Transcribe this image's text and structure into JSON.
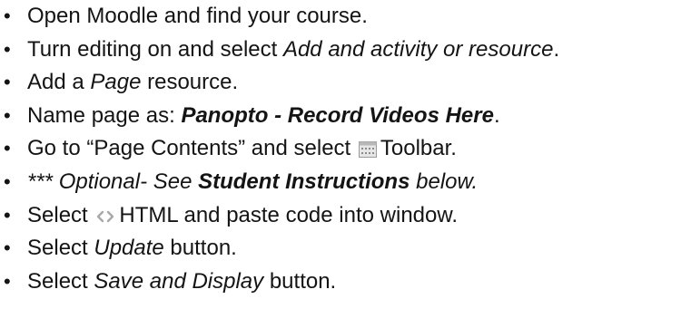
{
  "bullet_char": "•",
  "items": [
    {
      "text": "Open Moodle and find your course."
    },
    {
      "pre": "Turn editing on and select ",
      "em": "Add and activity or resource",
      "post": "."
    },
    {
      "pre": "Add a ",
      "em": "Page",
      "post": " resource."
    },
    {
      "pre": "Name page as: ",
      "strong_em": "Panopto - Record Videos Here",
      "post": "."
    },
    {
      "pre": "Go to “Page Contents” and select ",
      "icon": "toolbar-icon",
      "post": "Toolbar."
    },
    {
      "em_pre": "*** Optional- See ",
      "strong_em": "Student Instructions",
      "em_post": " below."
    },
    {
      "pre": "Select ",
      "icon": "html-code-icon",
      "post": "HTML and paste code into window."
    },
    {
      "pre": "Select ",
      "em": "Update",
      "post": " button."
    },
    {
      "pre": "Select ",
      "em": "Save and Display",
      "post": " button."
    }
  ],
  "colors": {
    "text": "#141414",
    "icon_gray": "#9a9a9a",
    "icon_light": "#e6e6e6"
  }
}
